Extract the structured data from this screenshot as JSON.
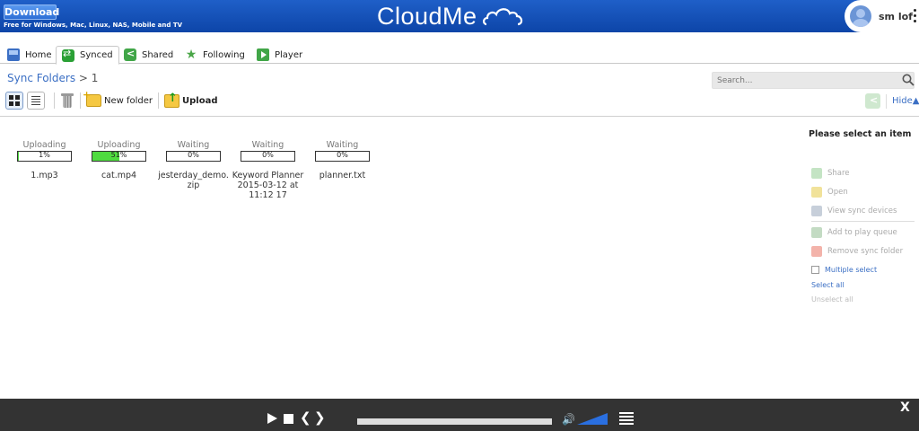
{
  "header": {
    "download_label": "Download",
    "download_sub": "Free for Windows, Mac, Linux, NAS, Mobile and TV",
    "logo_text": "CloudMe",
    "username": "sm lof",
    "bg_color": "#1552b8"
  },
  "tabs": [
    {
      "label": "Home",
      "icon": "home-icon",
      "active": false
    },
    {
      "label": "Synced",
      "icon": "sync-icon",
      "active": true
    },
    {
      "label": "Shared",
      "icon": "share-icon",
      "active": false
    },
    {
      "label": "Following",
      "icon": "star-icon",
      "active": false
    },
    {
      "label": "Player",
      "icon": "play-icon",
      "active": false
    }
  ],
  "breadcrumb": {
    "root": "Sync Folders",
    "sep": ">",
    "current": "1"
  },
  "search": {
    "placeholder": "Search..."
  },
  "toolbar": {
    "new_folder": "New folder",
    "upload": "Upload",
    "hide": "Hide▲"
  },
  "files": [
    {
      "status": "Uploading",
      "progress": 1,
      "progress_label": "1%",
      "name": "1.mp3"
    },
    {
      "status": "Uploading",
      "progress": 51,
      "progress_label": "51%",
      "name": "cat.mp4"
    },
    {
      "status": "Waiting",
      "progress": 0,
      "progress_label": "0%",
      "name": "jesterday_demo.zip"
    },
    {
      "status": "Waiting",
      "progress": 0,
      "progress_label": "0%",
      "name": "Keyword Planner 2015-03-12 at 11:12 17"
    },
    {
      "status": "Waiting",
      "progress": 0,
      "progress_label": "0%",
      "name": "planner.txt"
    }
  ],
  "panel": {
    "title": "Please select an item",
    "actions": [
      "Share",
      "Open",
      "View sync devices",
      "Add to play queue",
      "Remove sync folder"
    ],
    "multiple_select": "Multiple select",
    "select_all": "Select all",
    "unselect_all": "Unselect all"
  },
  "player": {
    "close": "X",
    "volume_level": 1.0,
    "progress_fill_color": "#4fdb3f"
  }
}
